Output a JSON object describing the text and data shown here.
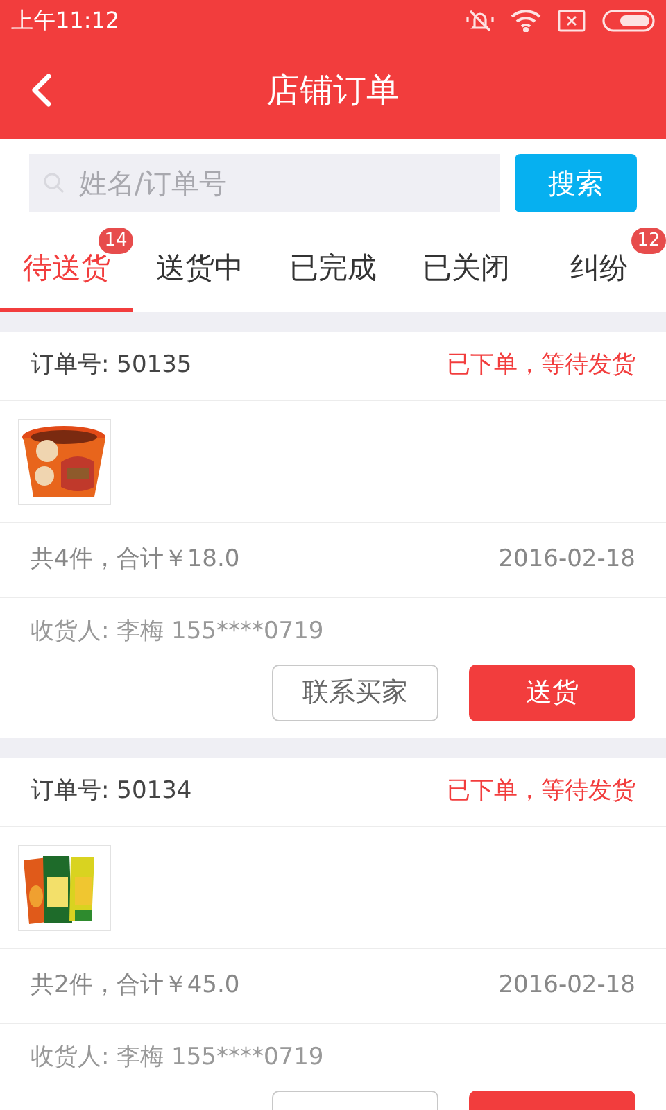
{
  "status_bar": {
    "time": "上午11:12"
  },
  "header": {
    "title": "店铺订单"
  },
  "search": {
    "placeholder": "姓名/订单号",
    "button": "搜索"
  },
  "tabs": [
    {
      "label": "待送货",
      "selected": true,
      "badge": "14"
    },
    {
      "label": "送货中",
      "selected": false
    },
    {
      "label": "已完成",
      "selected": false
    },
    {
      "label": "已关闭",
      "selected": false
    },
    {
      "label": "纠纷",
      "selected": false,
      "badge": "12"
    }
  ],
  "orders": [
    {
      "order_label": "订单号: 50135",
      "status": "已下单，等待发货",
      "summary": "共4件，合计￥18.0",
      "date": "2016-02-18",
      "recipient": "收货人: 李梅 155****0719",
      "actions": [
        {
          "kind": "outline",
          "label": "联系买家"
        },
        {
          "kind": "primary",
          "label": "送货"
        }
      ]
    },
    {
      "order_label": "订单号: 50134",
      "status": "已下单，等待发货",
      "summary": "共2件，合计￥45.0",
      "date": "2016-02-18",
      "recipient": "收货人: 李梅 155****0719",
      "actions": [
        {
          "kind": "outline"
        },
        {
          "kind": "primary"
        }
      ]
    }
  ]
}
